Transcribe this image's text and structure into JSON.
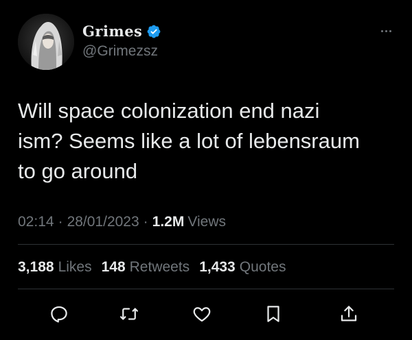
{
  "user": {
    "display_name": "Grimes",
    "handle": "@Grimezsz",
    "verified": true
  },
  "tweet": {
    "text": "Will space colonization end nazi\nism?  Seems like a lot of lebensraum\nto go around",
    "time": "02:14",
    "date": "28/01/2023",
    "views_count": "1.2M",
    "views_label": "Views"
  },
  "stats": {
    "likes_count": "3,188",
    "likes_label": "Likes",
    "retweets_count": "148",
    "retweets_label": "Retweets",
    "quotes_count": "1,433",
    "quotes_label": "Quotes"
  },
  "icons": {
    "more": "more-icon",
    "reply": "reply-icon",
    "retweet": "retweet-icon",
    "like": "heart-icon",
    "bookmark": "bookmark-icon",
    "share": "share-icon"
  },
  "colors": {
    "background": "#000000",
    "text": "#e7e9ea",
    "secondary": "#71767b",
    "verified": "#1d9bf0",
    "divider": "#2f3336"
  }
}
